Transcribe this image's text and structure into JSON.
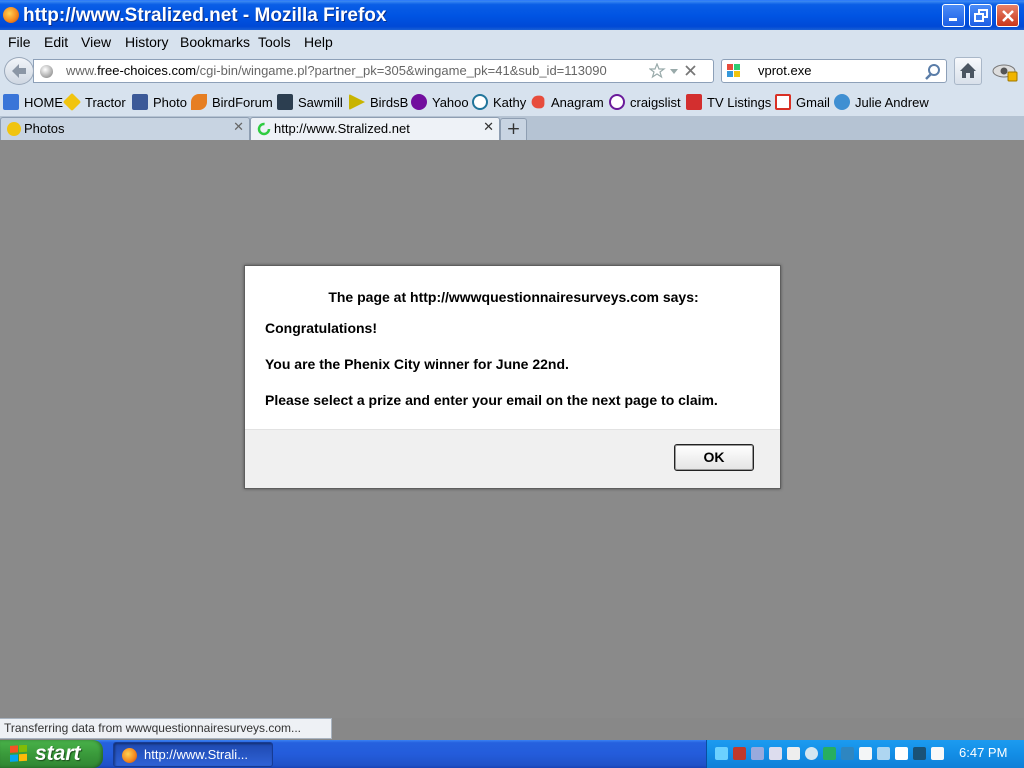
{
  "window": {
    "title": "http://www.Stralized.net - Mozilla Firefox"
  },
  "menu": {
    "items": [
      "File",
      "Edit",
      "View",
      "History",
      "Bookmarks",
      "Tools",
      "Help"
    ]
  },
  "nav": {
    "url_prefix": "www.",
    "url_domain": "free-choices.com",
    "url_path": "/cgi-bin/wingame.pl?partner_pk=305&wingame_pk=41&sub_id=113090",
    "search_value": "vprot.exe"
  },
  "bookmarks": [
    {
      "label": "HOME",
      "icon": "google-icon",
      "color": "#3a75d8"
    },
    {
      "label": "Tractor",
      "icon": "tractor-sign-icon",
      "color": "#f1c40f"
    },
    {
      "label": "Photo",
      "icon": "photo-icon",
      "color": "#3b5998"
    },
    {
      "label": "BirdForum",
      "icon": "bird-icon",
      "color": "#e67e22"
    },
    {
      "label": "Sawmill",
      "icon": "sawmill-icon",
      "color": "#2c3e50"
    },
    {
      "label": "BirdsB",
      "icon": "bird-flag-icon",
      "color": "#c8b400"
    },
    {
      "label": "Yahoo",
      "icon": "yahoo-icon",
      "color": "#720e9e"
    },
    {
      "label": "Kathy",
      "icon": "wordpress-icon",
      "color": "#21759b"
    },
    {
      "label": "Anagram",
      "icon": "fish-icon",
      "color": "#e74c3c"
    },
    {
      "label": "craigslist",
      "icon": "peace-icon",
      "color": "#6a1b9a"
    },
    {
      "label": "TV Listings",
      "icon": "tv-guide-icon",
      "color": "#d32f2f"
    },
    {
      "label": "Gmail",
      "icon": "gmail-icon",
      "color": "#d93025"
    },
    {
      "label": "Julie Andrew",
      "icon": "puzzle-icon",
      "color": "#3f8fd2"
    }
  ],
  "tabs": [
    {
      "label": "Photos"
    },
    {
      "label": "http://www.Stralized.net"
    }
  ],
  "dialog": {
    "title": "The page at http://wwwquestionnairesurveys.com says:",
    "line1": "Congratulations!",
    "line2": "You are the Phenix City winner for June 22nd.",
    "line3": "Please select a prize and enter your email on the next page to claim.",
    "ok_label": "OK"
  },
  "status": {
    "text": "Transferring data from wwwquestionnairesurveys.com..."
  },
  "taskbar": {
    "start_label": "start",
    "task_label": "http://www.Strali...",
    "clock": "6:47 PM"
  },
  "colors": {
    "xp_blue": "#0054e3",
    "chrome": "#d7e2ee",
    "content_gray": "#8a8a8a"
  }
}
